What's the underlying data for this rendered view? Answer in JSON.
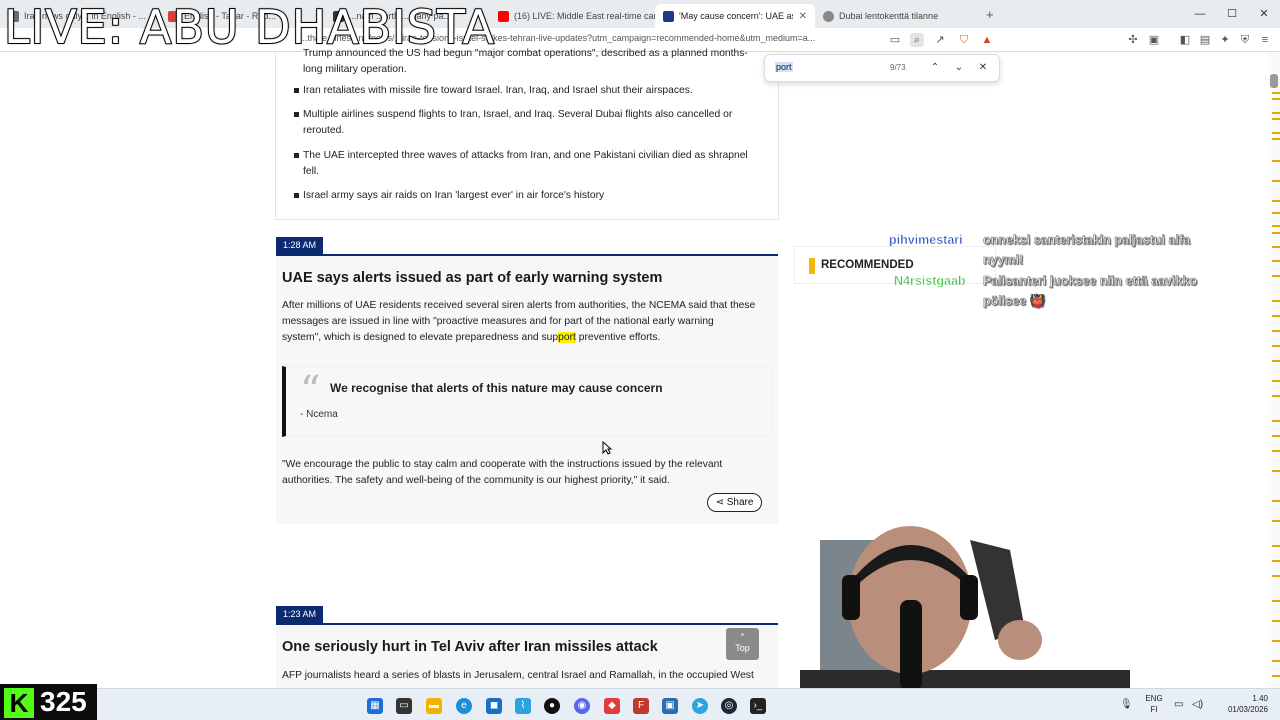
{
  "overlay": {
    "live_title": "LIVE: ABU DHABISTA",
    "viewer_count": "325"
  },
  "tabs": [
    {
      "label": "Iran news only... in English - ...",
      "color": "#6d6d6d"
    },
    {
      "label": "English - Tabar - Red...",
      "color": "#d64040"
    },
    {
      "label": "...nain ...arth ...many pa...",
      "color": "#333333"
    },
    {
      "label": "(16) LIVE: Middle East real-time came...",
      "color": "#ff0000"
    },
    {
      "label": "'May cause concern': UAE asks p...",
      "color": "#1d3a8a",
      "active": true
    },
    {
      "label": "Dubai lentokenttä tilanne",
      "color": "#888888"
    }
  ],
  "url": "...thale...irles...nn/news/...iran-tensions-israel-strikes-tehran-live-updates?utm_campaign=recommended-home&utm_medium=a...",
  "find": {
    "query": "port",
    "count": "9/73"
  },
  "summary_bullets": [
    "Trump announced the US had begun \"major combat operations\", described as a planned months-long military operation.",
    "Iran retaliates with missile fire toward Israel. Iran, Iraq, and Israel shut their airspaces.",
    "Multiple airlines suspend flights to Iran, Israel, and Iraq. Several Dubai flights also cancelled or rerouted.",
    "The UAE intercepted three waves of attacks from Iran, and one Pakistani civilian died as shrapnel fell.",
    "Israel army says air raids on Iran 'largest ever' in air force's history"
  ],
  "post1": {
    "time": "1:28 AM",
    "headline": "UAE says alerts issued as part of early warning system",
    "para_a1": "After millions of UAE residents received several siren alerts from authorities, the NCEMA said that these",
    "para_a2": "messages are issued in line with \"proactive measures and for ",
    "para_a2_hl": "",
    "para_a2_rest": "part of the national early warning",
    "para_a3_pre": "system\", which is designed to elevate preparedness and sup",
    "para_a3_hl": "port",
    "para_a3_post": " preventive efforts.",
    "quote_text": "We recognise that alerts of this nature may cause concern",
    "quote_source": "- Ncema",
    "para_b1": "\"We encourage the public to stay calm and cooperate with the instructions issued by the relevant",
    "para_b2": "authorities. The safety and well-being of the community is our highest priority,\" it said.",
    "share_label": "Share"
  },
  "post2": {
    "time": "1:23 AM",
    "headline": "One seriously hurt in Tel Aviv after Iran missiles attack",
    "para_pre": "AFP journalists heard a series of blasts in Jerusalem, ",
    "para_hl": "central",
    "para_post": " Israel and Ramallah, in the occupied West"
  },
  "top_button": {
    "arrow": "⌃",
    "label": "Top"
  },
  "sidebar": {
    "recommended": "RECOMMENDED"
  },
  "chat": [
    {
      "user": "pihvimestari",
      "user_color": "#2a55c8",
      "msg1": "onneksi santeristakin paljastui alfa",
      "msg2": "nyymi!"
    },
    {
      "user": "N4rsistgaab",
      "user_color": "#49c24a",
      "msg1": "Palisanteri juoksee niin että aavikko",
      "msg2": "pölisee 👹"
    }
  ],
  "taskbar": {
    "lang1": "ENG",
    "lang2": "FI",
    "time": "1.40",
    "date": "01/03/2026"
  },
  "colors": {
    "accent": "#0b2a6f",
    "highlight": "#ffee00",
    "kick": "#53fc18"
  }
}
